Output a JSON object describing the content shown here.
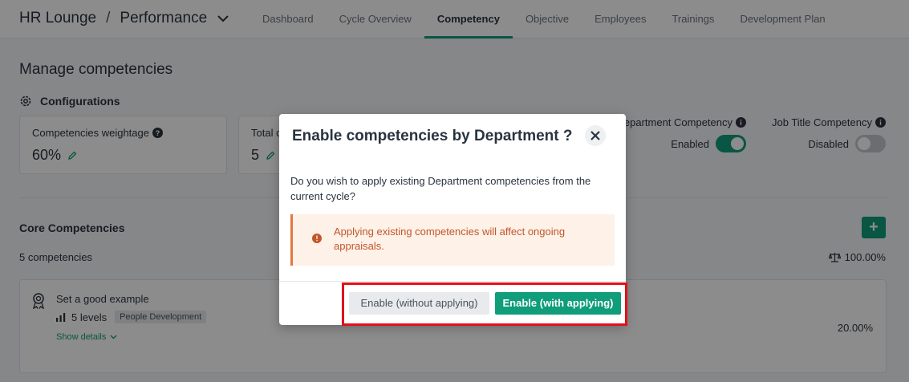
{
  "header": {
    "app_name": "HR Lounge",
    "separator": "/",
    "module": "Performance",
    "tabs": [
      {
        "label": "Dashboard"
      },
      {
        "label": "Cycle Overview"
      },
      {
        "label": "Competency"
      },
      {
        "label": "Objective"
      },
      {
        "label": "Employees"
      },
      {
        "label": "Trainings"
      },
      {
        "label": "Development Plan"
      }
    ],
    "active_tab": "Competency"
  },
  "page": {
    "title": "Manage competencies",
    "config_title": "Configurations",
    "cards": [
      {
        "label": "Competencies weightage",
        "value": "60%"
      },
      {
        "label": "Total c",
        "value": "5"
      }
    ],
    "toggles": [
      {
        "label": "epartment Competency",
        "state": "Enabled",
        "on": true
      },
      {
        "label": "Job Title Competency",
        "state": "Disabled",
        "on": false
      }
    ],
    "core": {
      "title": "Core Competencies",
      "count": "5 competencies",
      "add_label": "+",
      "total_weight": "100.00%",
      "items": [
        {
          "name": "Set a good example",
          "levels": "5 levels",
          "tag": "People Development",
          "show_details": "Show details",
          "weight": "20.00%"
        }
      ]
    }
  },
  "modal": {
    "title": "Enable competencies by Department ?",
    "body": "Do you wish to apply existing Department competencies from the current cycle?",
    "warning": "Applying existing competencies will affect ongoing appraisals.",
    "secondary_button": "Enable (without applying)",
    "primary_button": "Enable (with applying)"
  },
  "colors": {
    "accent": "#0f9d7a",
    "warning_text": "#c4562a",
    "warning_bg": "#fdf1e8",
    "highlight": "#e0101a"
  }
}
